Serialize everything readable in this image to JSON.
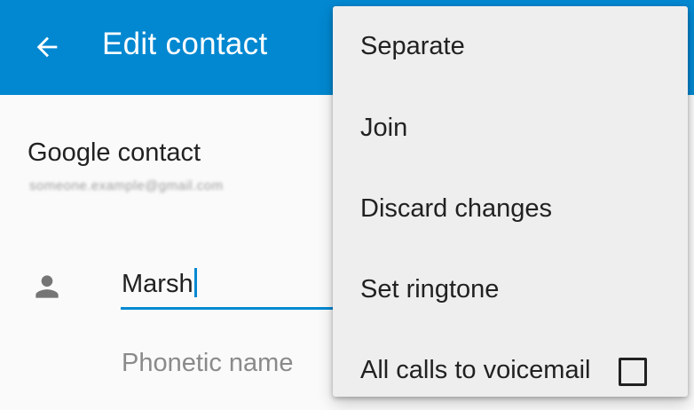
{
  "app_bar": {
    "title": "Edit contact",
    "back_icon": "arrow-back-icon",
    "background": "#0288d1"
  },
  "account": {
    "type": "Google contact",
    "email": "someone.example@gmail.com"
  },
  "name_field": {
    "icon": "person-icon",
    "value": "Marsh",
    "accent": "#0288d1"
  },
  "phonetic_field": {
    "placeholder": "Phonetic name"
  },
  "overflow_menu": {
    "items": [
      {
        "label": "Separate"
      },
      {
        "label": "Join"
      },
      {
        "label": "Discard changes"
      },
      {
        "label": "Set ringtone"
      },
      {
        "label": "All calls to voicemail",
        "checkbox": false
      }
    ]
  }
}
